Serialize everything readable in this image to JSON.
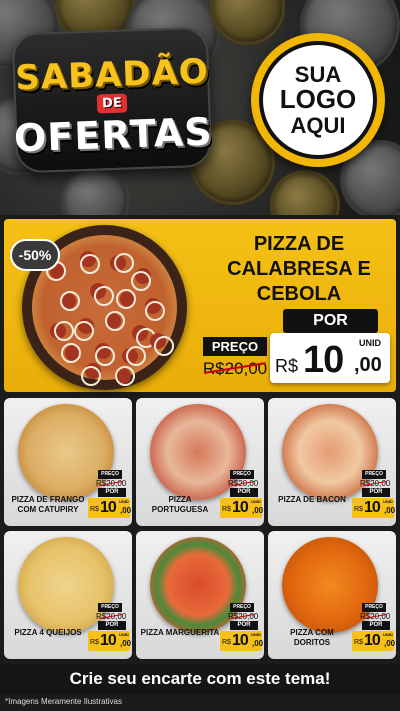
{
  "header": {
    "title_line1": "SABADÃO",
    "title_line2": "DE",
    "title_line3": "OFERTAS",
    "logo_line1": "SUA",
    "logo_line2": "LOGO",
    "logo_line3": "AQUI"
  },
  "featured": {
    "discount": "-50%",
    "name_line1": "PIZZA DE",
    "name_line2": "CALABRESA E",
    "name_line3": "CEBOLA",
    "por_label": "POR",
    "preco_label": "PREÇO",
    "old_price": "R$20,00",
    "currency": "R$",
    "price_int": "10",
    "price_cents": ",00",
    "unit": "UNID"
  },
  "products": [
    {
      "name": "PIZZA DE FRANGO COM CATUPIRY",
      "preco_label": "PREÇO",
      "old_price": "R$20,00",
      "por_label": "POR",
      "currency": "R$",
      "price_int": "10",
      "price_cents": ",00",
      "unit": "UNID"
    },
    {
      "name": "PIZZA PORTUGUESA",
      "preco_label": "PREÇO",
      "old_price": "R$20,00",
      "por_label": "POR",
      "currency": "R$",
      "price_int": "10",
      "price_cents": ",00",
      "unit": "UNID"
    },
    {
      "name": "PIZZA DE BACON",
      "preco_label": "PREÇO",
      "old_price": "R$20,00",
      "por_label": "POR",
      "currency": "R$",
      "price_int": "10",
      "price_cents": ",00",
      "unit": "UNID"
    },
    {
      "name": "PIZZA 4 QUEIJOS",
      "preco_label": "PREÇO",
      "old_price": "R$20,00",
      "por_label": "POR",
      "currency": "R$",
      "price_int": "10",
      "price_cents": ",00",
      "unit": "UNID"
    },
    {
      "name": "PIZZA MARGUERITA",
      "preco_label": "PREÇO",
      "old_price": "R$20,00",
      "por_label": "POR",
      "currency": "R$",
      "price_int": "10",
      "price_cents": ",00",
      "unit": "UNID"
    },
    {
      "name": "PIZZA COM DORITOS",
      "preco_label": "PREÇO",
      "old_price": "R$20,00",
      "por_label": "POR",
      "currency": "R$",
      "price_int": "10",
      "price_cents": ",00",
      "unit": "UNID"
    }
  ],
  "cta": "Crie seu encarte com este tema!",
  "footnote": "*Imagens Meramente Ilustrativas",
  "colors": {
    "accent": "#f5c116",
    "dark": "#111111",
    "strike": "#cc0000"
  }
}
